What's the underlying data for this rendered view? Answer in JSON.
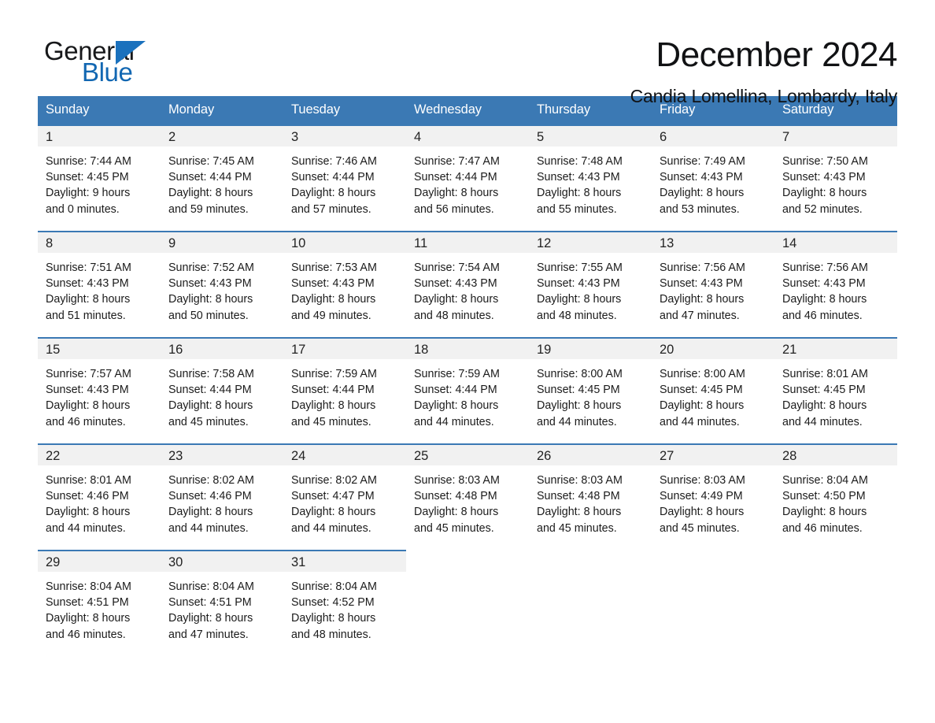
{
  "logo": {
    "text_primary": "General",
    "text_secondary": "Blue",
    "triangle_color": "#1a71bd",
    "primary_color": "#17181a",
    "secondary_color": "#1267b2"
  },
  "header": {
    "title": "December 2024",
    "subtitle": "Candia Lomellina, Lombardy, Italy"
  },
  "theme": {
    "header_row_bg": "#3b79b4",
    "day_band_bg": "#f1f1f1",
    "cell_top_border": "#3b79b4",
    "text_color": "#1b1b1b"
  },
  "weekdays": [
    "Sunday",
    "Monday",
    "Tuesday",
    "Wednesday",
    "Thursday",
    "Friday",
    "Saturday"
  ],
  "weeks": [
    [
      {
        "day": "1",
        "info": "Sunrise: 7:44 AM\nSunset: 4:45 PM\nDaylight: 9 hours\nand 0 minutes."
      },
      {
        "day": "2",
        "info": "Sunrise: 7:45 AM\nSunset: 4:44 PM\nDaylight: 8 hours\nand 59 minutes."
      },
      {
        "day": "3",
        "info": "Sunrise: 7:46 AM\nSunset: 4:44 PM\nDaylight: 8 hours\nand 57 minutes."
      },
      {
        "day": "4",
        "info": "Sunrise: 7:47 AM\nSunset: 4:44 PM\nDaylight: 8 hours\nand 56 minutes."
      },
      {
        "day": "5",
        "info": "Sunrise: 7:48 AM\nSunset: 4:43 PM\nDaylight: 8 hours\nand 55 minutes."
      },
      {
        "day": "6",
        "info": "Sunrise: 7:49 AM\nSunset: 4:43 PM\nDaylight: 8 hours\nand 53 minutes."
      },
      {
        "day": "7",
        "info": "Sunrise: 7:50 AM\nSunset: 4:43 PM\nDaylight: 8 hours\nand 52 minutes."
      }
    ],
    [
      {
        "day": "8",
        "info": "Sunrise: 7:51 AM\nSunset: 4:43 PM\nDaylight: 8 hours\nand 51 minutes."
      },
      {
        "day": "9",
        "info": "Sunrise: 7:52 AM\nSunset: 4:43 PM\nDaylight: 8 hours\nand 50 minutes."
      },
      {
        "day": "10",
        "info": "Sunrise: 7:53 AM\nSunset: 4:43 PM\nDaylight: 8 hours\nand 49 minutes."
      },
      {
        "day": "11",
        "info": "Sunrise: 7:54 AM\nSunset: 4:43 PM\nDaylight: 8 hours\nand 48 minutes."
      },
      {
        "day": "12",
        "info": "Sunrise: 7:55 AM\nSunset: 4:43 PM\nDaylight: 8 hours\nand 48 minutes."
      },
      {
        "day": "13",
        "info": "Sunrise: 7:56 AM\nSunset: 4:43 PM\nDaylight: 8 hours\nand 47 minutes."
      },
      {
        "day": "14",
        "info": "Sunrise: 7:56 AM\nSunset: 4:43 PM\nDaylight: 8 hours\nand 46 minutes."
      }
    ],
    [
      {
        "day": "15",
        "info": "Sunrise: 7:57 AM\nSunset: 4:43 PM\nDaylight: 8 hours\nand 46 minutes."
      },
      {
        "day": "16",
        "info": "Sunrise: 7:58 AM\nSunset: 4:44 PM\nDaylight: 8 hours\nand 45 minutes."
      },
      {
        "day": "17",
        "info": "Sunrise: 7:59 AM\nSunset: 4:44 PM\nDaylight: 8 hours\nand 45 minutes."
      },
      {
        "day": "18",
        "info": "Sunrise: 7:59 AM\nSunset: 4:44 PM\nDaylight: 8 hours\nand 44 minutes."
      },
      {
        "day": "19",
        "info": "Sunrise: 8:00 AM\nSunset: 4:45 PM\nDaylight: 8 hours\nand 44 minutes."
      },
      {
        "day": "20",
        "info": "Sunrise: 8:00 AM\nSunset: 4:45 PM\nDaylight: 8 hours\nand 44 minutes."
      },
      {
        "day": "21",
        "info": "Sunrise: 8:01 AM\nSunset: 4:45 PM\nDaylight: 8 hours\nand 44 minutes."
      }
    ],
    [
      {
        "day": "22",
        "info": "Sunrise: 8:01 AM\nSunset: 4:46 PM\nDaylight: 8 hours\nand 44 minutes."
      },
      {
        "day": "23",
        "info": "Sunrise: 8:02 AM\nSunset: 4:46 PM\nDaylight: 8 hours\nand 44 minutes."
      },
      {
        "day": "24",
        "info": "Sunrise: 8:02 AM\nSunset: 4:47 PM\nDaylight: 8 hours\nand 44 minutes."
      },
      {
        "day": "25",
        "info": "Sunrise: 8:03 AM\nSunset: 4:48 PM\nDaylight: 8 hours\nand 45 minutes."
      },
      {
        "day": "26",
        "info": "Sunrise: 8:03 AM\nSunset: 4:48 PM\nDaylight: 8 hours\nand 45 minutes."
      },
      {
        "day": "27",
        "info": "Sunrise: 8:03 AM\nSunset: 4:49 PM\nDaylight: 8 hours\nand 45 minutes."
      },
      {
        "day": "28",
        "info": "Sunrise: 8:04 AM\nSunset: 4:50 PM\nDaylight: 8 hours\nand 46 minutes."
      }
    ],
    [
      {
        "day": "29",
        "info": "Sunrise: 8:04 AM\nSunset: 4:51 PM\nDaylight: 8 hours\nand 46 minutes."
      },
      {
        "day": "30",
        "info": "Sunrise: 8:04 AM\nSunset: 4:51 PM\nDaylight: 8 hours\nand 47 minutes."
      },
      {
        "day": "31",
        "info": "Sunrise: 8:04 AM\nSunset: 4:52 PM\nDaylight: 8 hours\nand 48 minutes."
      },
      {
        "day": "",
        "info": ""
      },
      {
        "day": "",
        "info": ""
      },
      {
        "day": "",
        "info": ""
      },
      {
        "day": "",
        "info": ""
      }
    ]
  ]
}
